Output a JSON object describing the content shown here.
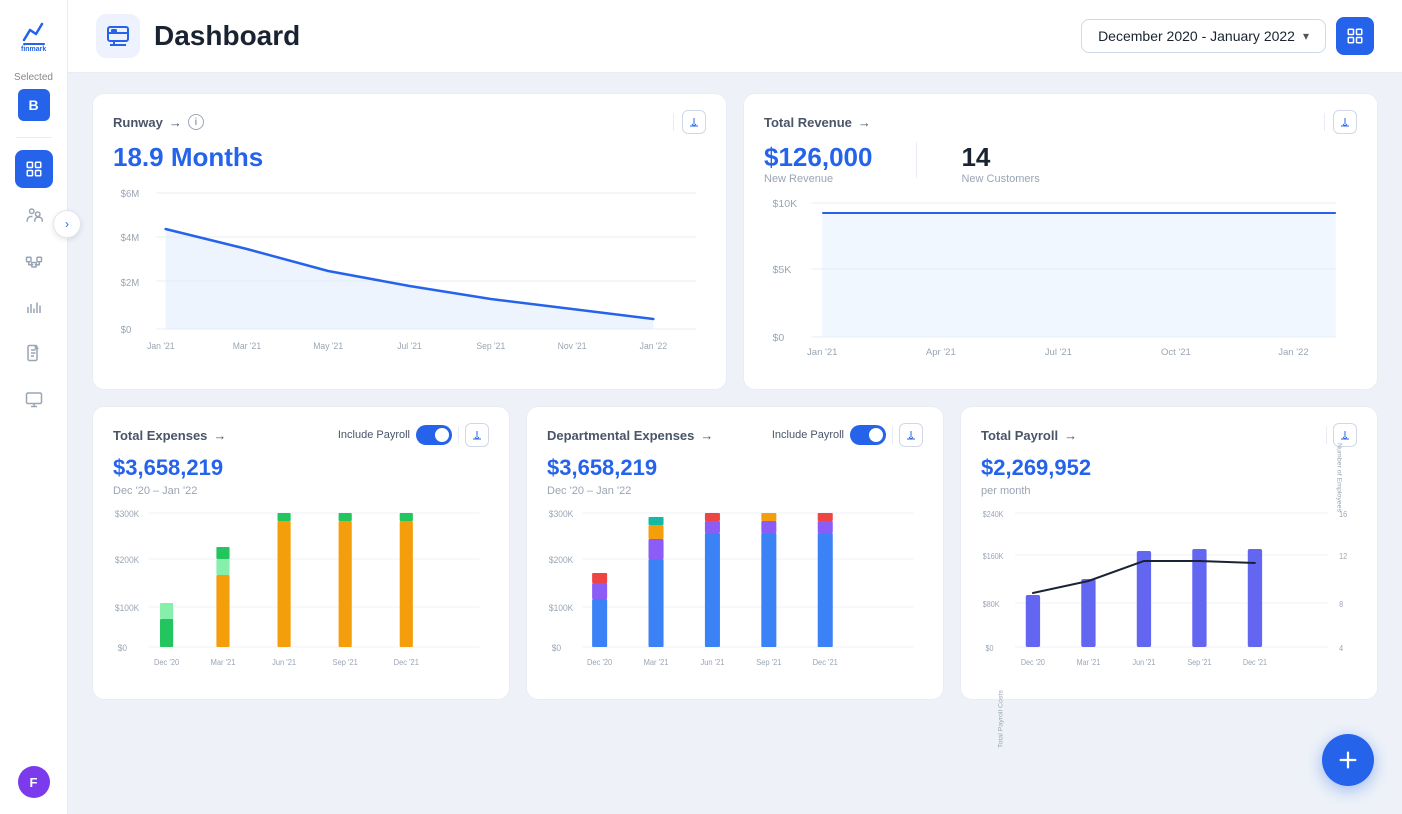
{
  "app": {
    "name": "finmark",
    "logo_text": "finmark"
  },
  "sidebar": {
    "selected_label": "Selected",
    "badge": "B",
    "nav_items": [
      {
        "id": "dashboard",
        "icon": "dashboard",
        "active": true
      },
      {
        "id": "team",
        "icon": "team",
        "active": false
      },
      {
        "id": "integrations",
        "icon": "integrations",
        "active": false
      },
      {
        "id": "charts",
        "icon": "charts",
        "active": false
      },
      {
        "id": "reports",
        "icon": "reports",
        "active": false
      },
      {
        "id": "display",
        "icon": "display",
        "active": false
      }
    ],
    "avatar_initials": "F"
  },
  "header": {
    "title": "Dashboard",
    "date_range": "December 2020 - January 2022",
    "date_range_start": "December 2020",
    "date_range_end": "January 2022"
  },
  "runway_card": {
    "title": "Runway",
    "value": "18.9 Months",
    "y_labels": [
      "$6M",
      "$4M",
      "$2M",
      "$0"
    ],
    "x_labels": [
      "Jan '21",
      "Mar '21",
      "May '21",
      "Jul '21",
      "Sep '21",
      "Nov '21",
      "Jan '22"
    ]
  },
  "total_revenue_card": {
    "title": "Total Revenue",
    "new_revenue_value": "$126,000",
    "new_revenue_label": "New Revenue",
    "new_customers_value": "14",
    "new_customers_label": "New Customers",
    "y_labels": [
      "$10K",
      "$5K",
      "$0"
    ],
    "x_labels": [
      "Jan '21",
      "Apr '21",
      "Jul '21",
      "Oct '21",
      "Jan '22"
    ]
  },
  "total_expenses_card": {
    "title": "Total Expenses",
    "include_payroll_label": "Include Payroll",
    "value": "$3,658,219",
    "date_range": "Dec '20 – Jan '22",
    "y_labels": [
      "$300K",
      "$200K",
      "$100K",
      "$0"
    ],
    "x_labels": [
      "Dec '20",
      "Mar '21",
      "Jun '21",
      "Sep '21",
      "Dec '21"
    ]
  },
  "departmental_expenses_card": {
    "title": "Departmental Expenses",
    "include_payroll_label": "Include Payroll",
    "value": "$3,658,219",
    "date_range": "Dec '20 – Jan '22",
    "y_labels": [
      "$300K",
      "$200K",
      "$100K",
      "$0"
    ],
    "x_labels": [
      "Dec '20",
      "Mar '21",
      "Jun '21",
      "Sep '21",
      "Dec '21"
    ]
  },
  "total_payroll_card": {
    "title": "Total Payroll",
    "value": "$2,269,952",
    "per_label": "per month",
    "y_labels_left": [
      "$240K",
      "$160K",
      "$80K",
      "$0"
    ],
    "y_labels_right": [
      "16",
      "12",
      "8",
      "4"
    ],
    "x_labels": [
      "Dec '20",
      "Mar '21",
      "Jun '21",
      "Sep '21",
      "Dec '21"
    ],
    "left_axis_label": "Total Payroll Costs",
    "right_axis_label": "Number of Employees"
  },
  "colors": {
    "primary": "#2563eb",
    "accent_blue": "#3b82f6",
    "light_blue": "#bfdbfe",
    "green": "#22c55e",
    "yellow": "#f59e0b",
    "orange": "#f97316",
    "red": "#ef4444",
    "purple": "#8b5cf6",
    "teal": "#14b8a6"
  }
}
